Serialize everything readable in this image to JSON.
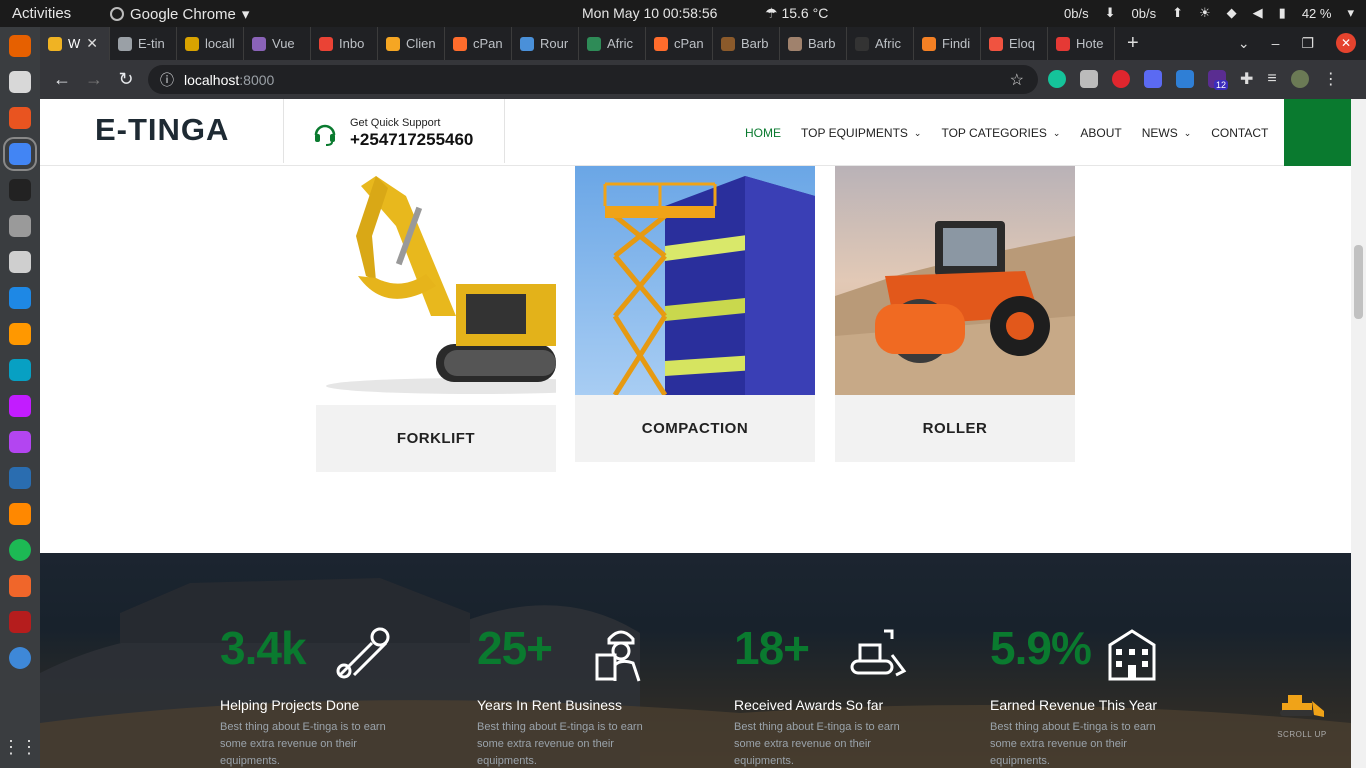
{
  "topbar": {
    "activities": "Activities",
    "app_name": "Google Chrome",
    "clock": "Mon May 10  00:58:56",
    "weather": "15.6 °C",
    "net_down": "0b/s",
    "net_up": "0b/s",
    "battery": "42 %"
  },
  "tabs": [
    {
      "label": "W",
      "color": "#f0b323",
      "active": true
    },
    {
      "label": "E-tin",
      "color": "#9aa0a6"
    },
    {
      "label": "locall",
      "color": "#d9a300"
    },
    {
      "label": "Vue",
      "color": "#8a63b8"
    },
    {
      "label": "Inbo",
      "color": "#ea4335"
    },
    {
      "label": "Clien",
      "color": "#f5a623"
    },
    {
      "label": "cPan",
      "color": "#ff6c2c"
    },
    {
      "label": "Rour",
      "color": "#4a90d9"
    },
    {
      "label": "Afric",
      "color": "#2e8b57"
    },
    {
      "label": "cPan",
      "color": "#ff6c2c"
    },
    {
      "label": "Barb",
      "color": "#8b5a2b"
    },
    {
      "label": "Barb",
      "color": "#a0826d"
    },
    {
      "label": "Afric",
      "color": "#333333"
    },
    {
      "label": "Findi",
      "color": "#f48024"
    },
    {
      "label": "Eloq",
      "color": "#f05340"
    },
    {
      "label": "Hote",
      "color": "#e53935"
    }
  ],
  "omnibox": {
    "host": "localhost",
    "port": ":8000"
  },
  "extensions_badge": "12",
  "site": {
    "logo": "E-TINGA",
    "support_label": "Get Quick Support",
    "support_phone": "+254717255460",
    "nav": [
      {
        "label": "HOME",
        "active": true,
        "dropdown": false
      },
      {
        "label": "TOP EQUIPMENTS",
        "active": false,
        "dropdown": true
      },
      {
        "label": "TOP CATEGORIES",
        "active": false,
        "dropdown": true
      },
      {
        "label": "ABOUT",
        "active": false,
        "dropdown": false
      },
      {
        "label": "NEWS",
        "active": false,
        "dropdown": true
      },
      {
        "label": "CONTACT",
        "active": false,
        "dropdown": false
      }
    ]
  },
  "categories": [
    {
      "name": "FORKLIFT",
      "image": "excavator-image"
    },
    {
      "name": "COMPACTION",
      "image": "scissor-lift-image"
    },
    {
      "name": "ROLLER",
      "image": "road-roller-image"
    }
  ],
  "stats": [
    {
      "value": "3.4k",
      "title": "Helping Projects Done",
      "desc": "Best thing about E-tinga is to earn some extra revenue on their equipments.",
      "icon": "tools-icon"
    },
    {
      "value": "25+",
      "title": "Years In Rent Business",
      "desc": "Best thing about E-tinga is to earn some extra revenue on their equipments.",
      "icon": "engineer-icon"
    },
    {
      "value": "18+",
      "title": "Received Awards So far",
      "desc": "Best thing about E-tinga is to earn some extra revenue on their equipments.",
      "icon": "bulldozer-icon"
    },
    {
      "value": "5.9%",
      "title": "Earned Revenue This Year",
      "desc": "Best thing about E-tinga is to earn some extra revenue on their equipments.",
      "icon": "building-icon"
    }
  ],
  "scroll_up_label": "SCROLL UP",
  "colors": {
    "brand_green": "#0a7a2f",
    "dark_band": "#1c2530"
  }
}
